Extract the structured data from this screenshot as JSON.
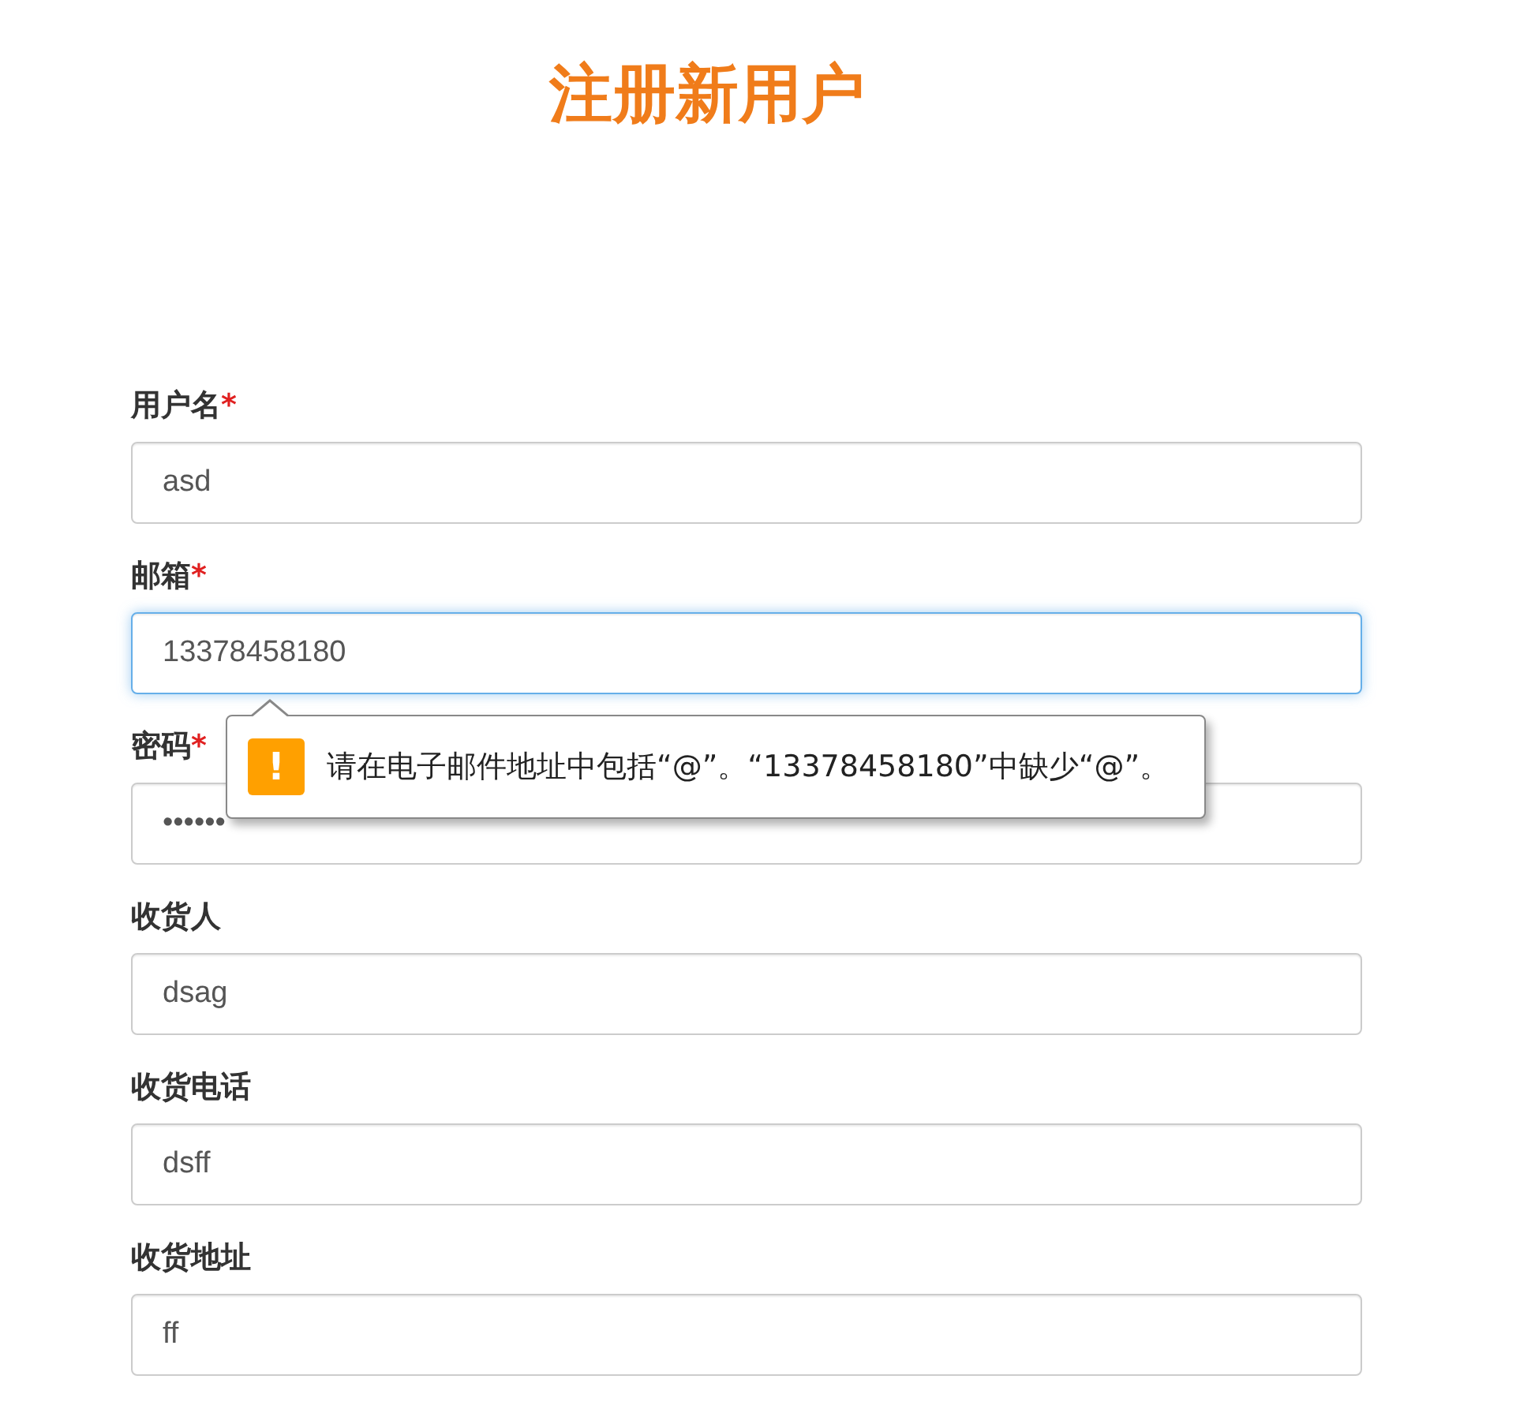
{
  "title": "注册新用户",
  "fields": [
    {
      "label": "用户名",
      "required": true,
      "required_mark": "*",
      "value": "asd",
      "focused": false
    },
    {
      "label": "邮箱",
      "required": true,
      "required_mark": "*",
      "value": "13378458180",
      "focused": true,
      "tooltip": {
        "icon": "!",
        "message": "请在电子邮件地址中包括“@”。“13378458180”中缺少“@”。"
      }
    },
    {
      "label": "密码",
      "required": true,
      "required_mark": "*",
      "value": "••••••",
      "focused": false
    },
    {
      "label": "收货人",
      "required": false,
      "value": "dsag",
      "focused": false
    },
    {
      "label": "收货电话",
      "required": false,
      "value": "dsff",
      "focused": false
    },
    {
      "label": "收货地址",
      "required": false,
      "value": "ff",
      "focused": false
    }
  ]
}
